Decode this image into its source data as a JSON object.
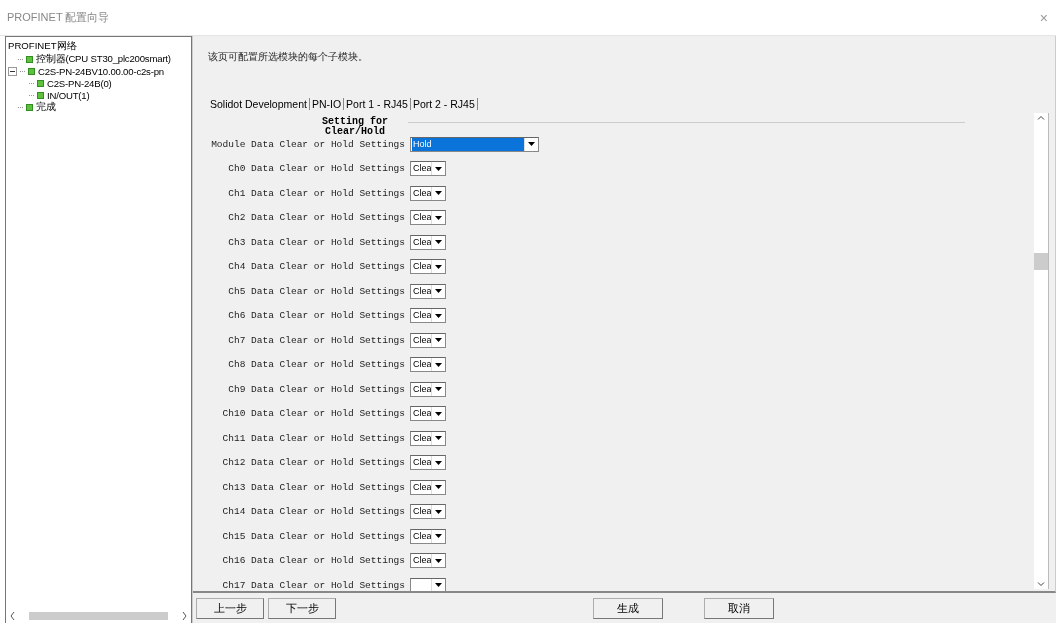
{
  "window": {
    "title": "PROFINET 配置向导",
    "close": "×"
  },
  "tree": {
    "root": "PROFINET网络",
    "items": [
      {
        "label": "控制器(CPU ST30_plc200smart)"
      },
      {
        "label": "C2S-PN-24BV10.00.00-c2s-pn",
        "expanded": true,
        "children": [
          {
            "label": "C2S-PN-24B(0)"
          },
          {
            "label": "IN/OUT(1)"
          }
        ]
      },
      {
        "label": "完成"
      }
    ]
  },
  "description": "该页可配置所选模块的每个子模块。",
  "tabs": [
    "Solidot Development",
    "PN-IO",
    "Port 1 - RJ45",
    "Port 2 - RJ45"
  ],
  "group": {
    "title": "Setting for Clear/Hold",
    "settings": [
      {
        "label": "Module Data Clear or Hold Settings",
        "value": "Hold",
        "kind": "wide",
        "focused": true
      },
      {
        "label": "Ch0 Data Clear or Hold Settings",
        "value": "Clea",
        "kind": "narrow",
        "focused": false
      },
      {
        "label": "Ch1 Data Clear or Hold Settings",
        "value": "Clea",
        "kind": "narrow",
        "focused": false
      },
      {
        "label": "Ch2 Data Clear or Hold Settings",
        "value": "Clea",
        "kind": "narrow",
        "focused": false
      },
      {
        "label": "Ch3 Data Clear or Hold Settings",
        "value": "Clea",
        "kind": "narrow",
        "focused": false
      },
      {
        "label": "Ch4 Data Clear or Hold Settings",
        "value": "Clea",
        "kind": "narrow",
        "focused": false
      },
      {
        "label": "Ch5 Data Clear or Hold Settings",
        "value": "Clea",
        "kind": "narrow",
        "focused": false
      },
      {
        "label": "Ch6 Data Clear or Hold Settings",
        "value": "Clea",
        "kind": "narrow",
        "focused": false
      },
      {
        "label": "Ch7 Data Clear or Hold Settings",
        "value": "Clea",
        "kind": "narrow",
        "focused": false
      },
      {
        "label": "Ch8 Data Clear or Hold Settings",
        "value": "Clea",
        "kind": "narrow",
        "focused": false
      },
      {
        "label": "Ch9 Data Clear or Hold Settings",
        "value": "Clea",
        "kind": "narrow",
        "focused": false
      },
      {
        "label": "Ch10 Data Clear or Hold Settings",
        "value": "Clea",
        "kind": "narrow",
        "focused": false
      },
      {
        "label": "Ch11 Data Clear or Hold Settings",
        "value": "Clea",
        "kind": "narrow",
        "focused": false
      },
      {
        "label": "Ch12 Data Clear or Hold Settings",
        "value": "Clea",
        "kind": "narrow",
        "focused": false
      },
      {
        "label": "Ch13 Data Clear or Hold Settings",
        "value": "Clea",
        "kind": "narrow",
        "focused": false
      },
      {
        "label": "Ch14 Data Clear or Hold Settings",
        "value": "Clea",
        "kind": "narrow",
        "focused": false
      },
      {
        "label": "Ch15 Data Clear or Hold Settings",
        "value": "Clea",
        "kind": "narrow",
        "focused": false
      },
      {
        "label": "Ch16 Data Clear or Hold Settings",
        "value": "Clea",
        "kind": "narrow",
        "focused": false
      },
      {
        "label": "Ch17 Data Clear or Hold Settings",
        "kind": "narrow",
        "focused": false
      }
    ]
  },
  "nav_buttons": [
    "上一步",
    "下一步"
  ],
  "action_buttons": [
    "生成",
    "取消"
  ]
}
